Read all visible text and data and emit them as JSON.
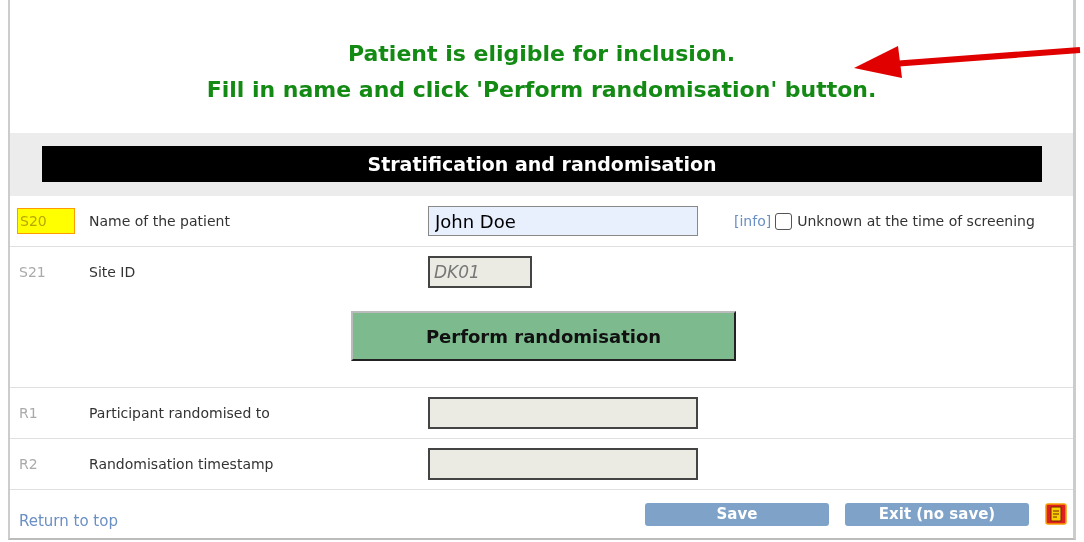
{
  "message": {
    "lines": [
      "Patient is eligible for inclusion.",
      "Fill in name and click 'Perform randomisation' button."
    ]
  },
  "section": {
    "title": "Stratification and randomisation"
  },
  "rows": [
    {
      "code": "S20",
      "highlighted": true,
      "label": "Name of the patient",
      "value": "John Doe",
      "readonly": false,
      "info": "[info]",
      "checkbox": {
        "label": "Unknown at the time of screening",
        "checked": false
      }
    },
    {
      "code": "S21",
      "highlighted": false,
      "label": "Site ID",
      "value": "DK01",
      "readonly": true,
      "action": "Perform randomisation"
    },
    {
      "code": "R1",
      "highlighted": false,
      "label": "Participant randomised to",
      "readonly": true
    },
    {
      "code": "R2",
      "highlighted": false,
      "label": "Randomisation timestamp",
      "readonly": true
    }
  ],
  "footer": {
    "link": "Return to top",
    "buttons": [
      "Save",
      "Exit (no save)"
    ]
  }
}
